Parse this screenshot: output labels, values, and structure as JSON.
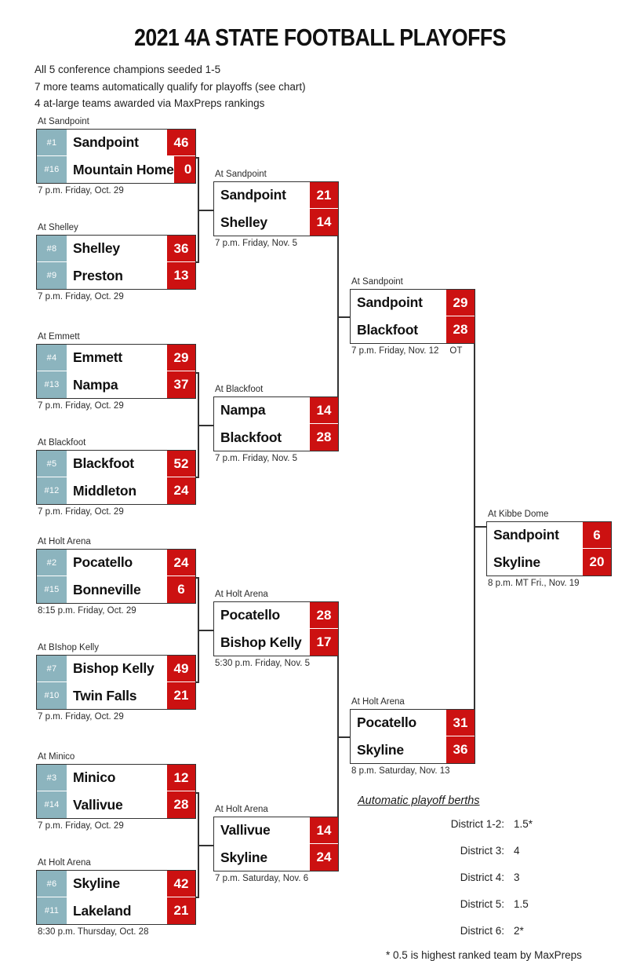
{
  "header": {
    "title": "2021 4A STATE FOOTBALL PLAYOFFS",
    "notes": [
      "All 5 conference champions seeded 1-5",
      "7 more teams automatically qualify for playoffs (see chart)",
      "4 at-large teams awarded via MaxPreps rankings"
    ]
  },
  "colors": {
    "seed_teal": "#8cb4be",
    "score_red": "#cc1111",
    "border": "#333333"
  },
  "round1": [
    {
      "venue": "At Sandpoint",
      "datetime": "7 p.m. Friday, Oct. 29",
      "top": {
        "seed": "#1",
        "team": "Sandpoint",
        "score": "46"
      },
      "bottom": {
        "seed": "#16",
        "team": "Mountain Home",
        "score": "0"
      }
    },
    {
      "venue": "At Shelley",
      "datetime": "7 p.m. Friday, Oct. 29",
      "top": {
        "seed": "#8",
        "team": "Shelley",
        "score": "36"
      },
      "bottom": {
        "seed": "#9",
        "team": "Preston",
        "score": "13"
      }
    },
    {
      "venue": "At Emmett",
      "datetime": "7 p.m. Friday, Oct. 29",
      "top": {
        "seed": "#4",
        "team": "Emmett",
        "score": "29"
      },
      "bottom": {
        "seed": "#13",
        "team": "Nampa",
        "score": "37"
      }
    },
    {
      "venue": "At Blackfoot",
      "datetime": "7 p.m. Friday, Oct. 29",
      "top": {
        "seed": "#5",
        "team": "Blackfoot",
        "score": "52"
      },
      "bottom": {
        "seed": "#12",
        "team": "Middleton",
        "score": "24"
      }
    },
    {
      "venue": "At Holt Arena",
      "datetime": "8:15 p.m. Friday, Oct. 29",
      "top": {
        "seed": "#2",
        "team": "Pocatello",
        "score": "24"
      },
      "bottom": {
        "seed": "#15",
        "team": "Bonneville",
        "score": "6"
      }
    },
    {
      "venue": "At BIshop Kelly",
      "datetime": "7 p.m. Friday, Oct. 29",
      "top": {
        "seed": "#7",
        "team": "Bishop Kelly",
        "score": "49"
      },
      "bottom": {
        "seed": "#10",
        "team": "Twin Falls",
        "score": "21"
      }
    },
    {
      "venue": "At Minico",
      "datetime": "7 p.m. Friday, Oct. 29",
      "top": {
        "seed": "#3",
        "team": "Minico",
        "score": "12"
      },
      "bottom": {
        "seed": "#14",
        "team": "Vallivue",
        "score": "28"
      }
    },
    {
      "venue": "At Holt Arena",
      "datetime": "8:30 p.m. Thursday, Oct. 28",
      "top": {
        "seed": "#6",
        "team": "Skyline",
        "score": "42"
      },
      "bottom": {
        "seed": "#11",
        "team": "Lakeland",
        "score": "21"
      }
    }
  ],
  "round2": [
    {
      "venue": "At Sandpoint",
      "datetime": "7 p.m. Friday, Nov. 5",
      "top": {
        "team": "Sandpoint",
        "score": "21"
      },
      "bottom": {
        "team": "Shelley",
        "score": "14"
      }
    },
    {
      "venue": "At Blackfoot",
      "datetime": "7 p.m. Friday, Nov. 5",
      "top": {
        "team": "Nampa",
        "score": "14"
      },
      "bottom": {
        "team": "Blackfoot",
        "score": "28"
      }
    },
    {
      "venue": "At Holt Arena",
      "datetime": "5:30 p.m. Friday, Nov. 5",
      "top": {
        "team": "Pocatello",
        "score": "28"
      },
      "bottom": {
        "team": "Bishop Kelly",
        "score": "17"
      }
    },
    {
      "venue": "At Holt Arena",
      "datetime": "7 p.m. Saturday, Nov. 6",
      "top": {
        "team": "Vallivue",
        "score": "14"
      },
      "bottom": {
        "team": "Skyline",
        "score": "24"
      }
    }
  ],
  "round3": [
    {
      "venue": "At Sandpoint",
      "datetime": "7 p.m. Friday, Nov. 12",
      "ot": "OT",
      "top": {
        "team": "Sandpoint",
        "score": "29"
      },
      "bottom": {
        "team": "Blackfoot",
        "score": "28"
      }
    },
    {
      "venue": "At Holt Arena",
      "datetime": "8 p.m. Saturday, Nov. 13",
      "ot": "",
      "top": {
        "team": "Pocatello",
        "score": "31"
      },
      "bottom": {
        "team": "Skyline",
        "score": "36"
      }
    }
  ],
  "final": {
    "venue": "At Kibbe Dome",
    "datetime": "8 p.m. MT Fri., Nov. 19",
    "top": {
      "team": "Sandpoint",
      "score": "6"
    },
    "bottom": {
      "team": "Skyline",
      "score": "20"
    }
  },
  "berths": {
    "title": "Automatic playoff berths",
    "rows": [
      {
        "label": "District 1-2:",
        "value": "1.5*"
      },
      {
        "label": "District 3:",
        "value": "4"
      },
      {
        "label": "District 4:",
        "value": "3"
      },
      {
        "label": "District 5:",
        "value": "1.5"
      },
      {
        "label": "District 6:",
        "value": "2*"
      }
    ],
    "footnote": "* 0.5 is highest ranked team by MaxPreps"
  }
}
